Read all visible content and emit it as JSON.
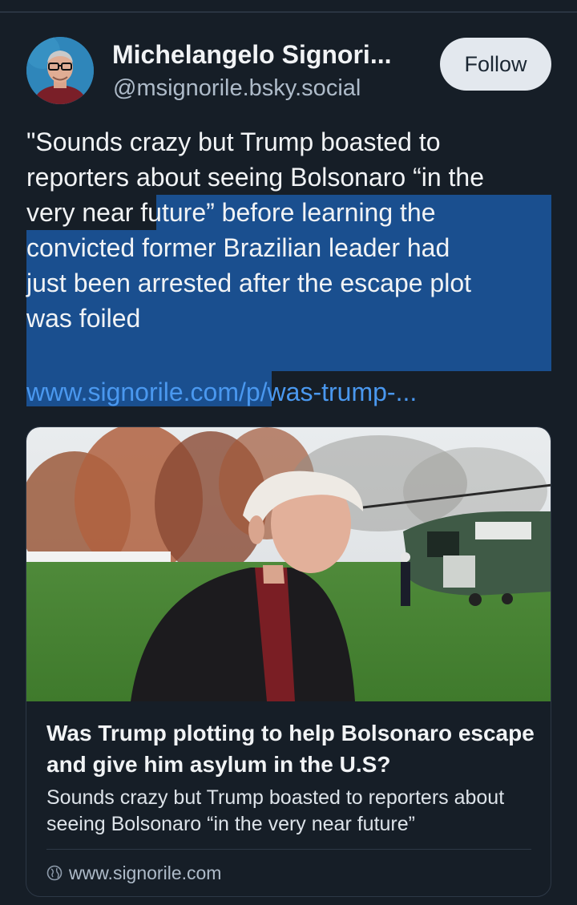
{
  "author": {
    "display_name": "Michelangelo Signori...",
    "handle": "@msignorile.bsky.social",
    "avatar_icon": "profile-photo"
  },
  "follow_label": "Follow",
  "post": {
    "lines": [
      "\"Sounds crazy but Trump boasted to",
      "reporters about seeing Bolsonaro “in the",
      "very near future” before learning the",
      "convicted former Brazilian leader had",
      "just been arrested after the  escape plot",
      "was foiled"
    ],
    "link": "www.signorile.com/p/was-trump-..."
  },
  "card": {
    "image_icon": "news-photo",
    "title": "Was Trump plotting to help Bolsonaro escape and give him asylum in the U.S?",
    "description": "Sounds crazy but Trump boasted to reporters about seeing Bolsonaro “in the very near future”",
    "domain": "www.signorile.com",
    "domain_icon": "globe-icon"
  },
  "colors": {
    "background": "#161e27",
    "selection": "#1a4f8f",
    "link": "#4a98ef",
    "follow_button": "#e3e8ee"
  }
}
